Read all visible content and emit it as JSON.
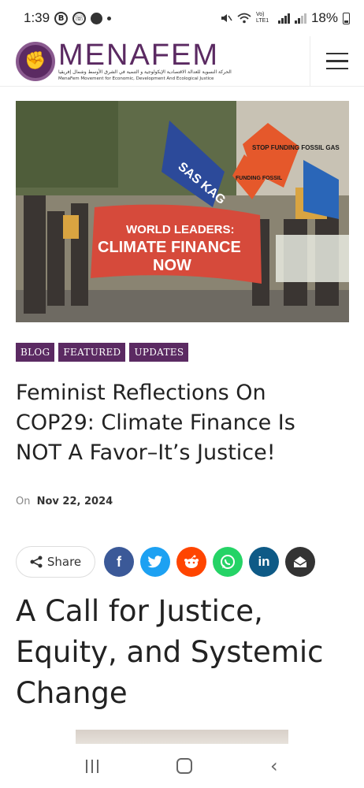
{
  "status_bar": {
    "time": "1:39",
    "icon_b": "B",
    "icon_whatsapp": "☏",
    "network": "Vo) LTE1",
    "battery": "18%"
  },
  "header": {
    "logo_name": "MENAFEM",
    "arabic_tagline": "الحركة النسوية للعدالة الاقتصادية الإيكولوجية و التنمية في الشرق الأوسط وشمال إفريقيا",
    "english_tagline": "MenaFem Movement for Economic, Development And Ecological Justice"
  },
  "hero": {
    "flag_text": "SAS KAG",
    "banner_line1": "WORLD LEADERS:",
    "banner_line2": "CLIMATE FINANCE",
    "banner_line3": "NOW",
    "sign_text_1": "STOP FUNDING FOSSIL GAS",
    "sign_text_2": "FUNDING FOSSIL"
  },
  "categories": [
    "BLOG",
    "FEATURED",
    "UPDATES"
  ],
  "article": {
    "title": "Feminist Reflections On COP29: Climate Finance Is NOT A Favor–It’s Justice!",
    "date_prefix": "On",
    "date": "Nov 22, 2024"
  },
  "share": {
    "label": "Share",
    "networks": [
      {
        "name": "facebook",
        "glyph": "f",
        "color": "#3b5998"
      },
      {
        "name": "twitter",
        "glyph": "t",
        "color": "#1da1f2"
      },
      {
        "name": "reddit",
        "glyph": "r",
        "color": "#ff4500"
      },
      {
        "name": "whatsapp",
        "glyph": "w",
        "color": "#25d366"
      },
      {
        "name": "linkedin",
        "glyph": "in",
        "color": "#0e5a86"
      },
      {
        "name": "email",
        "glyph": "@",
        "color": "#333333"
      }
    ]
  },
  "section_heading": "A Call for Justice, Equity, and Systemic Change",
  "colors": {
    "brand": "#5b2a62"
  }
}
